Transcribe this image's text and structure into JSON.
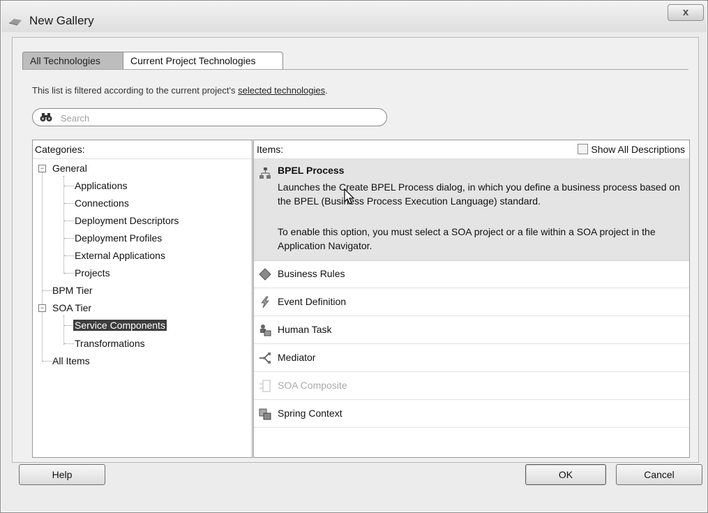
{
  "window": {
    "title": "New Gallery",
    "close_glyph": "x"
  },
  "tabs": [
    {
      "label": "All Technologies",
      "active": false
    },
    {
      "label": "Current Project Technologies",
      "active": true
    }
  ],
  "filter_note": {
    "prefix": "This list is filtered according to the current project's ",
    "link": "selected technologies",
    "suffix": "."
  },
  "search": {
    "placeholder": "Search",
    "value": ""
  },
  "categories": {
    "header": "Categories:",
    "tree": [
      {
        "label": "General",
        "level": 0,
        "expanded": true
      },
      {
        "label": "Applications",
        "level": 1
      },
      {
        "label": "Connections",
        "level": 1
      },
      {
        "label": "Deployment Descriptors",
        "level": 1
      },
      {
        "label": "Deployment Profiles",
        "level": 1
      },
      {
        "label": "External Applications",
        "level": 1
      },
      {
        "label": "Projects",
        "level": 1
      },
      {
        "label": "BPM Tier",
        "level": 0
      },
      {
        "label": "SOA Tier",
        "level": 0,
        "expanded": true
      },
      {
        "label": "Service Components",
        "level": 1,
        "selected": true
      },
      {
        "label": "Transformations",
        "level": 1
      },
      {
        "label": "All Items",
        "level": 0
      }
    ]
  },
  "items": {
    "header": "Items:",
    "show_all_descriptions": "Show All Descriptions",
    "selected": {
      "title": "BPEL Process",
      "description": "Launches the Create BPEL Process dialog, in which you define a business process based on the BPEL (Business Process Execution Language) standard.",
      "note": "To enable this option, you must select a SOA project or a file within a SOA project in the Application Navigator."
    },
    "list": [
      {
        "label": "Business Rules",
        "icon": "business-rules-icon",
        "enabled": true
      },
      {
        "label": "Event Definition",
        "icon": "event-definition-icon",
        "enabled": true
      },
      {
        "label": "Human Task",
        "icon": "human-task-icon",
        "enabled": true
      },
      {
        "label": "Mediator",
        "icon": "mediator-icon",
        "enabled": true
      },
      {
        "label": "SOA Composite",
        "icon": "soa-composite-icon",
        "enabled": false
      },
      {
        "label": "Spring Context",
        "icon": "spring-context-icon",
        "enabled": true
      }
    ]
  },
  "buttons": {
    "help": "Help",
    "ok": "OK",
    "cancel": "Cancel"
  }
}
